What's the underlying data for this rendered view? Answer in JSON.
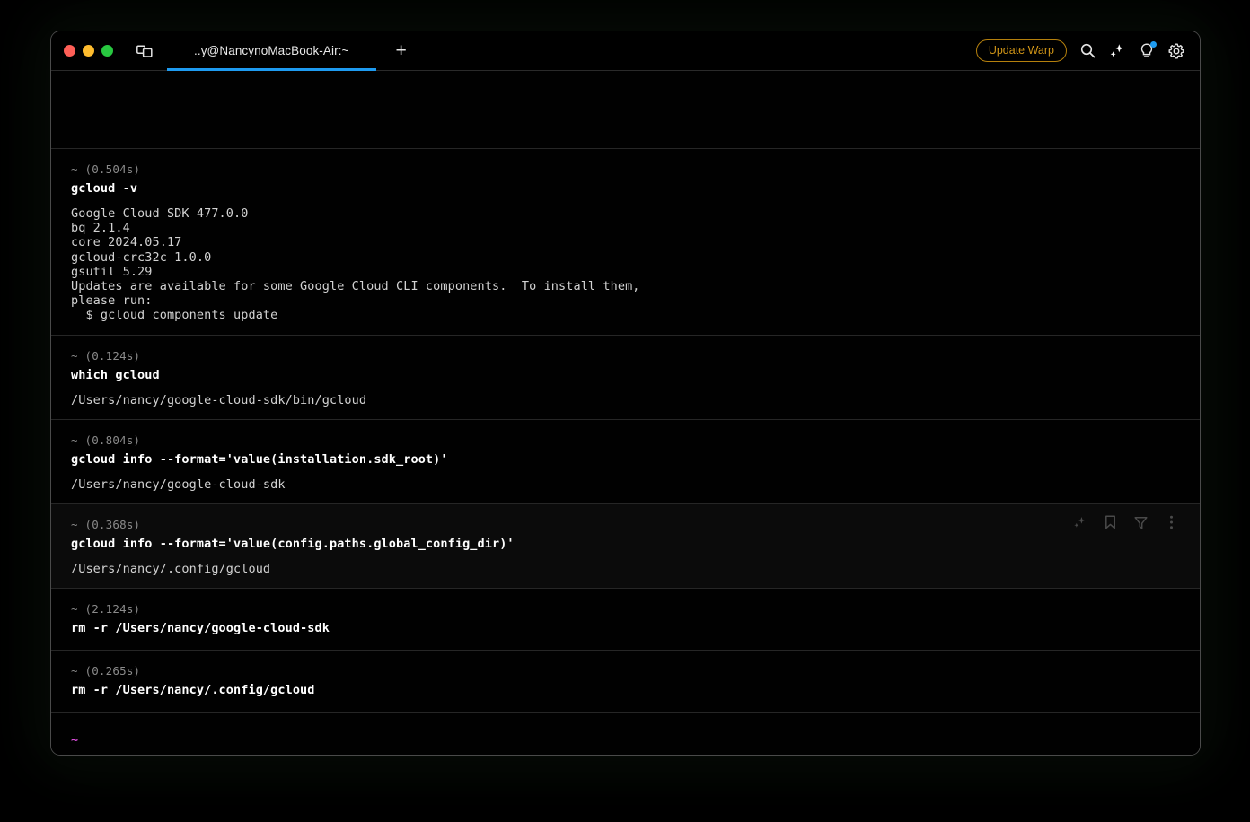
{
  "window": {
    "traffic_lights": [
      {
        "name": "close",
        "color": "#ff5f57"
      },
      {
        "name": "minimize",
        "color": "#febc2e"
      },
      {
        "name": "zoom",
        "color": "#28c840"
      }
    ]
  },
  "titlebar": {
    "panes_icon": "split-panes-icon",
    "tab": {
      "title": "..y@NancynoMacBook-Air:~",
      "active": true,
      "underline_color": "#1e9bf0"
    },
    "new_tab_label": "+",
    "update_button": {
      "label": "Update Warp",
      "color": "#cf9417"
    },
    "icons": [
      {
        "name": "search-icon",
        "glyph": "magnifier"
      },
      {
        "name": "ai-sparkle-icon",
        "glyph": "sparkle"
      },
      {
        "name": "lightbulb-icon",
        "glyph": "lightbulb",
        "badge": true,
        "badge_color": "#1e9bf0"
      },
      {
        "name": "gear-icon",
        "glyph": "gear"
      }
    ]
  },
  "terminal": {
    "blocks": [
      {
        "prompt": "~",
        "duration": "(0.504s)",
        "command": "gcloud -v",
        "output": "Google Cloud SDK 477.0.0\nbq 2.1.4\ncore 2024.05.17\ngcloud-crc32c 1.0.0\ngsutil 5.29\nUpdates are available for some Google Cloud CLI components.  To install them,\nplease run:\n  $ gcloud components update",
        "hovered": false
      },
      {
        "prompt": "~",
        "duration": "(0.124s)",
        "command": "which gcloud",
        "output": "/Users/nancy/google-cloud-sdk/bin/gcloud",
        "hovered": false
      },
      {
        "prompt": "~",
        "duration": "(0.804s)",
        "command": "gcloud info --format='value(installation.sdk_root)'",
        "output": "/Users/nancy/google-cloud-sdk",
        "hovered": false
      },
      {
        "prompt": "~",
        "duration": "(0.368s)",
        "command": "gcloud info --format='value(config.paths.global_config_dir)'",
        "output": "/Users/nancy/.config/gcloud",
        "hovered": true,
        "actions": [
          {
            "name": "ai-sparkle-icon",
            "glyph": "sparkle"
          },
          {
            "name": "bookmark-icon",
            "glyph": "bookmark"
          },
          {
            "name": "filter-icon",
            "glyph": "funnel"
          },
          {
            "name": "more-options-icon",
            "glyph": "kebab"
          }
        ]
      },
      {
        "prompt": "~",
        "duration": "(2.124s)",
        "command": "rm -r /Users/nancy/google-cloud-sdk",
        "output": "",
        "hovered": false
      },
      {
        "prompt": "~",
        "duration": "(0.265s)",
        "command": "rm -r /Users/nancy/.config/gcloud",
        "output": "",
        "hovered": false
      }
    ],
    "active_prompt": {
      "symbol": "~",
      "symbol_color": "#d44bd4",
      "input_value": "",
      "cursor_color": "#2bb3f3"
    }
  }
}
